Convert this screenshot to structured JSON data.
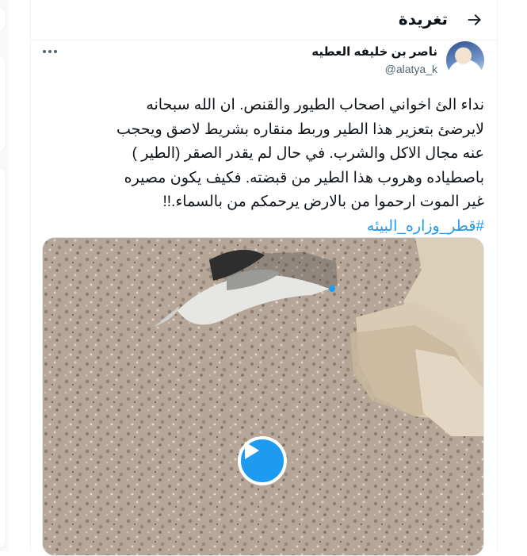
{
  "header": {
    "title": "تغريدة",
    "back_icon": "arrow-right-icon"
  },
  "author": {
    "display_name": "ناصر بن خليفه العطيه",
    "handle": "@alatya_k"
  },
  "tweet": {
    "lines": [
      "نداء الئ اخواني اصحاب الطيور والقنص. ان الله سبحانه",
      "لايرضئ بتعزير هذا الطير وربط منقاره بشريط لاصق ويحجب",
      "عنه مجال الاكل والشرب. في حال لم يقدر الصقر (الطير )",
      "باصطياده وهروب هذا الطير من قبضته. فكيف يكون مصيره",
      "غير الموت ارحموا من بالارض يرحمكم من بالسماء.!!"
    ],
    "hashtag": "#قطر_وزاره_البيئه"
  },
  "colors": {
    "accent": "#1d9bf0",
    "text": "#0f1419",
    "secondary_text": "#536471"
  }
}
